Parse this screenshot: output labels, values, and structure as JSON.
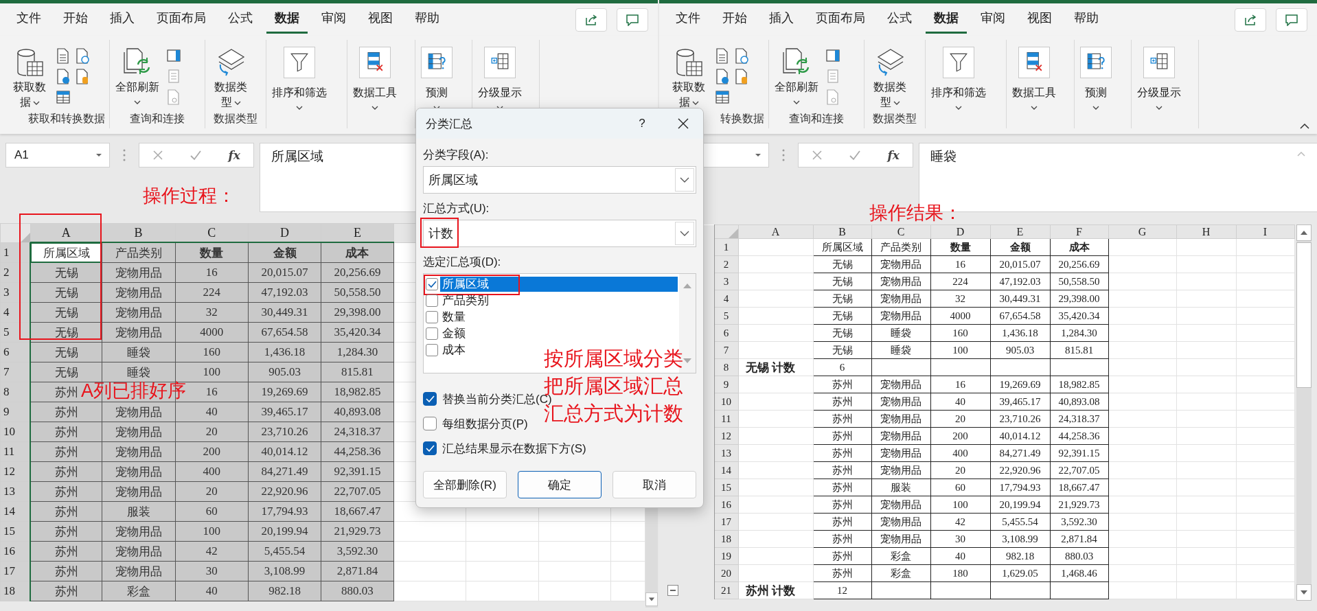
{
  "windows": [
    {
      "tabs": [
        {
          "label": "文件",
          "selected": false
        },
        {
          "label": "开始",
          "selected": false
        },
        {
          "label": "插入",
          "selected": false
        },
        {
          "label": "页面布局",
          "selected": false
        },
        {
          "label": "公式",
          "selected": false
        },
        {
          "label": "数据",
          "selected": true
        },
        {
          "label": "审阅",
          "selected": false
        },
        {
          "label": "视图",
          "selected": false
        },
        {
          "label": "帮助",
          "selected": false
        }
      ],
      "ribbon": {
        "groups": [
          {
            "label": "获取和转换数据",
            "button": "获取数据"
          },
          {
            "label": "查询和连接",
            "button": "全部刷新"
          },
          {
            "label": "数据类型",
            "button": "数据类型"
          },
          {
            "button": "排序和筛选"
          },
          {
            "button": "数据工具"
          },
          {
            "button": "预测"
          },
          {
            "button": "分级显示"
          }
        ]
      },
      "name_box": "A1",
      "function_button": "fx",
      "formula": "所属区域",
      "note": "操作过程：",
      "sheet": {
        "columns": [
          {
            "label": "A",
            "framed": true
          },
          "B",
          "C",
          "D",
          "E"
        ],
        "note": "A列已排好序",
        "rows": [
          {
            "header": "1",
            "selected": true,
            "cells": [
              {
                "text": "所属区域",
                "active": true
              },
              "产品类别",
              {
                "text": "数量",
                "bold": true
              },
              {
                "text": "金额",
                "bold": true
              },
              {
                "text": "成本",
                "bold": true
              }
            ]
          },
          {
            "header": "2",
            "selected": true,
            "cells": [
              "无锡",
              "宠物用品",
              "16",
              "20,015.07",
              "20,256.69"
            ]
          },
          {
            "header": "3",
            "selected": true,
            "cells": [
              "无锡",
              "宠物用品",
              "224",
              "47,192.03",
              "50,558.50"
            ]
          },
          {
            "header": "4",
            "selected": true,
            "cells": [
              "无锡",
              "宠物用品",
              "32",
              "30,449.31",
              "29,398.00"
            ]
          },
          {
            "header": "5",
            "selected": true,
            "cells": [
              "无锡",
              "宠物用品",
              "4000",
              "67,654.58",
              "35,420.34"
            ]
          },
          {
            "header": "6",
            "selected": true,
            "cells": [
              "无锡",
              "睡袋",
              "160",
              "1,436.18",
              "1,284.30"
            ]
          },
          {
            "header": "7",
            "selected": true,
            "cells": [
              "无锡",
              "睡袋",
              "100",
              "905.03",
              "815.81"
            ]
          },
          {
            "header": "8",
            "selected": true,
            "cells": [
              "苏州",
              null,
              "16",
              "19,269.69",
              "18,982.85"
            ]
          },
          {
            "header": "9",
            "selected": true,
            "cells": [
              "苏州",
              "宠物用品",
              "40",
              "39,465.17",
              "40,893.08"
            ]
          },
          {
            "header": "10",
            "selected": true,
            "cells": [
              "苏州",
              "宠物用品",
              "20",
              "23,710.26",
              "24,318.37"
            ]
          },
          {
            "header": "11",
            "selected": true,
            "cells": [
              "苏州",
              "宠物用品",
              "200",
              "40,014.12",
              "44,258.36"
            ]
          },
          {
            "header": "12",
            "selected": true,
            "cells": [
              "苏州",
              "宠物用品",
              "400",
              "84,271.49",
              "92,391.15"
            ]
          },
          {
            "header": "13",
            "selected": true,
            "cells": [
              "苏州",
              "宠物用品",
              "20",
              "22,920.96",
              "22,707.05"
            ]
          },
          {
            "header": "14",
            "selected": true,
            "cells": [
              "苏州",
              "服装",
              "60",
              "17,794.93",
              "18,667.47"
            ]
          },
          {
            "header": "15",
            "selected": true,
            "cells": [
              "苏州",
              "宠物用品",
              "100",
              "20,199.94",
              "21,929.73"
            ]
          },
          {
            "header": "16",
            "selected": true,
            "cells": [
              "苏州",
              "宠物用品",
              "42",
              "5,455.54",
              "3,592.30"
            ]
          },
          {
            "header": "17",
            "selected": true,
            "cells": [
              "苏州",
              "宠物用品",
              "30",
              "3,108.99",
              "2,871.84"
            ]
          },
          {
            "header": "18",
            "selected": true,
            "cells": [
              "苏州",
              "彩盒",
              "40",
              "982.18",
              "880.03"
            ]
          }
        ]
      }
    },
    {
      "tabs": [
        {
          "label": "文件",
          "selected": false
        },
        {
          "label": "开始",
          "selected": false
        },
        {
          "label": "插入",
          "selected": false
        },
        {
          "label": "页面布局",
          "selected": false
        },
        {
          "label": "公式",
          "selected": false
        },
        {
          "label": "数据",
          "selected": true
        },
        {
          "label": "审阅",
          "selected": false
        },
        {
          "label": "视图",
          "selected": false
        },
        {
          "label": "帮助",
          "selected": false
        }
      ],
      "ribbon": {
        "groups": [
          {
            "label": "转换数据",
            "button": "获取数据"
          },
          {
            "label": "查询和连接",
            "button": "全部刷新"
          },
          {
            "label": "数据类型",
            "button": "数据类型"
          },
          {
            "button": "排序和筛选"
          },
          {
            "button": "数据工具"
          },
          {
            "button": "预测"
          },
          {
            "button": "分级显示"
          }
        ]
      },
      "collapse_button": true,
      "function_button": "fx",
      "formula": "睡袋",
      "note": "操作结果：",
      "sheet": {
        "columns": [
          "A",
          "B",
          "C",
          "D",
          "E",
          "F",
          "G",
          "H",
          "I"
        ],
        "rows": [
          {
            "header": "1",
            "selected": false,
            "cells": [
              null,
              "所属区域",
              "产品类别",
              {
                "text": "数量",
                "bold": true
              },
              {
                "text": "金额",
                "bold": true
              },
              {
                "text": "成本",
                "bold": true
              }
            ]
          },
          {
            "header": "2",
            "selected": false,
            "cells": [
              null,
              "无锡",
              "宠物用品",
              "16",
              "20,015.07",
              "20,256.69"
            ]
          },
          {
            "header": "3",
            "selected": false,
            "cells": [
              null,
              "无锡",
              "宠物用品",
              "224",
              "47,192.03",
              "50,558.50"
            ]
          },
          {
            "header": "4",
            "selected": false,
            "cells": [
              null,
              "无锡",
              "宠物用品",
              "32",
              "30,449.31",
              "29,398.00"
            ]
          },
          {
            "header": "5",
            "selected": false,
            "cells": [
              null,
              "无锡",
              "宠物用品",
              "4000",
              "67,654.58",
              "35,420.34"
            ]
          },
          {
            "header": "6",
            "selected": false,
            "cells": [
              null,
              "无锡",
              "睡袋",
              "160",
              "1,436.18",
              "1,284.30"
            ]
          },
          {
            "header": "7",
            "selected": false,
            "cells": [
              null,
              "无锡",
              "睡袋",
              "100",
              "905.03",
              "815.81"
            ]
          },
          {
            "header": "8",
            "selected": false,
            "cells": [
              {
                "text": "无锡  计数",
                "bold": true
              },
              "6"
            ]
          },
          {
            "header": "9",
            "selected": false,
            "cells": [
              null,
              "苏州",
              "宠物用品",
              "16",
              "19,269.69",
              "18,982.85"
            ]
          },
          {
            "header": "10",
            "selected": false,
            "cells": [
              null,
              "苏州",
              "宠物用品",
              "40",
              "39,465.17",
              "40,893.08"
            ]
          },
          {
            "header": "11",
            "selected": false,
            "cells": [
              null,
              "苏州",
              "宠物用品",
              "20",
              "23,710.26",
              "24,318.37"
            ]
          },
          {
            "header": "12",
            "selected": false,
            "cells": [
              null,
              "苏州",
              "宠物用品",
              "200",
              "40,014.12",
              "44,258.36"
            ]
          },
          {
            "header": "13",
            "selected": false,
            "cells": [
              null,
              "苏州",
              "宠物用品",
              "400",
              "84,271.49",
              "92,391.15"
            ]
          },
          {
            "header": "14",
            "selected": false,
            "cells": [
              null,
              "苏州",
              "宠物用品",
              "20",
              "22,920.96",
              "22,707.05"
            ]
          },
          {
            "header": "15",
            "selected": false,
            "cells": [
              null,
              "苏州",
              "服装",
              "60",
              "17,794.93",
              "18,667.47"
            ]
          },
          {
            "header": "16",
            "selected": false,
            "cells": [
              null,
              "苏州",
              "宠物用品",
              "100",
              "20,199.94",
              "21,929.73"
            ]
          },
          {
            "header": "17",
            "selected": false,
            "cells": [
              null,
              "苏州",
              "宠物用品",
              "42",
              "5,455.54",
              "3,592.30"
            ]
          },
          {
            "header": "18",
            "selected": false,
            "cells": [
              null,
              "苏州",
              "宠物用品",
              "30",
              "3,108.99",
              "2,871.84"
            ]
          },
          {
            "header": "19",
            "selected": false,
            "cells": [
              null,
              "苏州",
              "彩盒",
              "40",
              "982.18",
              "880.03"
            ]
          },
          {
            "header": "20",
            "selected": false,
            "cells": [
              null,
              "苏州",
              "彩盒",
              "180",
              "1,629.05",
              "1,468.46"
            ]
          },
          {
            "header": "21",
            "selected": false,
            "collapse_button": true,
            "cells": [
              {
                "text": "苏州  计数",
                "bold": true
              },
              "12"
            ]
          }
        ]
      }
    }
  ],
  "dialog": {
    "title": "分类汇总",
    "help": "?",
    "fields": [
      {
        "label": "分类字段(A):",
        "value": "所属区域"
      },
      {
        "label": "汇总方式(U):",
        "value": "计数",
        "highlighted": true
      }
    ],
    "list": {
      "label": "选定汇总项(D):",
      "items": [
        {
          "label": "所属区域",
          "checked": true,
          "selected": true,
          "highlighted": true
        },
        {
          "label": "产品类别",
          "checked": false,
          "selected": false
        },
        {
          "label": "数量",
          "checked": false,
          "selected": false
        },
        {
          "label": "金额",
          "checked": false,
          "selected": false
        },
        {
          "label": "成本",
          "checked": false,
          "selected": false
        }
      ]
    },
    "notes": [
      "按所属区域分类",
      "把所属区域汇总",
      "汇总方式为计数"
    ],
    "options": [
      {
        "label": "替换当前分类汇总(C)",
        "checked": true
      },
      {
        "label": "每组数据分页(P)",
        "checked": false
      },
      {
        "label": "汇总结果显示在数据下方(S)",
        "checked": true
      }
    ],
    "buttons": [
      {
        "label": "全部删除(R)",
        "default": false
      },
      {
        "label": "确定",
        "default": true
      },
      {
        "label": "取消",
        "default": false
      }
    ]
  }
}
